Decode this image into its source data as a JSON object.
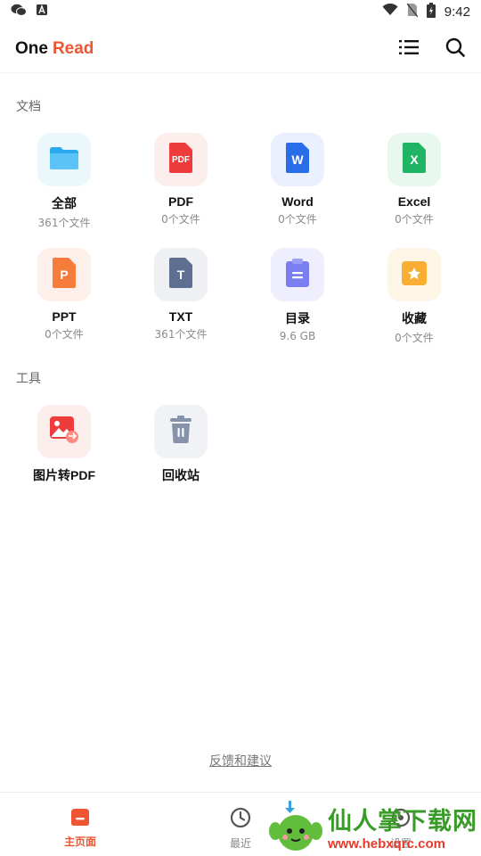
{
  "status_bar": {
    "time": "9:42"
  },
  "app_bar": {
    "brand_one": "One",
    "brand_read": "Read"
  },
  "sections": {
    "documents_title": "文档",
    "tools_title": "工具"
  },
  "documents": [
    {
      "label": "全部",
      "count": "361个文件",
      "icon": "folder-icon",
      "bg": "#eaf7fb",
      "color": "#2ba9f0"
    },
    {
      "label": "PDF",
      "count": "0个文件",
      "icon": "pdf-icon",
      "bg": "#fdeeee",
      "color": "#ee3b3b"
    },
    {
      "label": "Word",
      "count": "0个文件",
      "icon": "word-icon",
      "bg": "#eaf0fd",
      "color": "#2a6de8"
    },
    {
      "label": "Excel",
      "count": "0个文件",
      "icon": "excel-icon",
      "bg": "#e9f8ef",
      "color": "#1fb564"
    },
    {
      "label": "PPT",
      "count": "0个文件",
      "icon": "ppt-icon",
      "bg": "#fdefe9",
      "color": "#f57c3a"
    },
    {
      "label": "TXT",
      "count": "361个文件",
      "icon": "txt-icon",
      "bg": "#eef0f4",
      "color": "#5f6f92"
    },
    {
      "label": "目录",
      "count": "9.6 GB",
      "icon": "catalog-icon",
      "bg": "#eeeefc",
      "color": "#7b7ef0"
    },
    {
      "label": "收藏",
      "count": "0个文件",
      "icon": "star-folder-icon",
      "bg": "#fdf5e6",
      "color": "#f7ae32"
    }
  ],
  "tools": [
    {
      "label": "图片转PDF",
      "icon": "image-to-pdf-icon",
      "bg": "#fdeeee",
      "color": "#ee3b3b"
    },
    {
      "label": "回收站",
      "icon": "trash-icon",
      "bg": "#f1f2f5",
      "color": "#8592aa"
    }
  ],
  "feedback": "反馈和建议",
  "tabs": [
    {
      "label": "主页面",
      "icon": "home-icon",
      "active": true
    },
    {
      "label": "最近",
      "icon": "clock-icon",
      "active": false
    },
    {
      "label": "设置",
      "icon": "settings-icon",
      "active": false
    }
  ],
  "watermark": {
    "title": "仙人掌下载网",
    "url": "www.hebxqrc.com"
  },
  "colors": {
    "accent": "#ee5533"
  }
}
